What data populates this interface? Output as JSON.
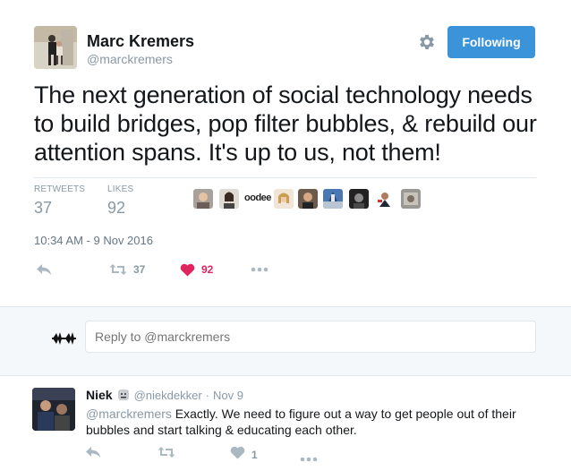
{
  "author": {
    "name": "Marc Kremers",
    "handle": "@marckremers"
  },
  "follow_button": {
    "label": "Following",
    "color": "#3b94d9"
  },
  "tweet": {
    "text": "The next generation of social technology needs to build bridges, pop filter bubbles, & rebuild our attention spans. It's up to us, not them!",
    "timestamp": "10:34 AM - 9 Nov 2016"
  },
  "stats": {
    "retweets_label": "RETWEETS",
    "retweets_value": "37",
    "likes_label": "LIKES",
    "likes_value": "92"
  },
  "likers": {
    "text_avatar": "oodee"
  },
  "actions": {
    "retweet_count": "37",
    "like_count": "92",
    "like_color": "#e0245e"
  },
  "reply_box": {
    "placeholder": "Reply to @marckremers"
  },
  "reply": {
    "name": "Niek",
    "handle": "@niekdekker",
    "separator": "·",
    "date": "Nov 9",
    "mention": "@marckremers",
    "text": " Exactly. We need to figure out a way to get people out of their bubbles and start talking & educating each other.",
    "like_count": "1"
  },
  "icons": {
    "settings": "gear-icon",
    "reply": "reply-arrow-icon",
    "retweet": "retweet-icon",
    "like": "heart-icon",
    "more": "more-dots-icon",
    "verified_face": "emoji-face-icon"
  }
}
